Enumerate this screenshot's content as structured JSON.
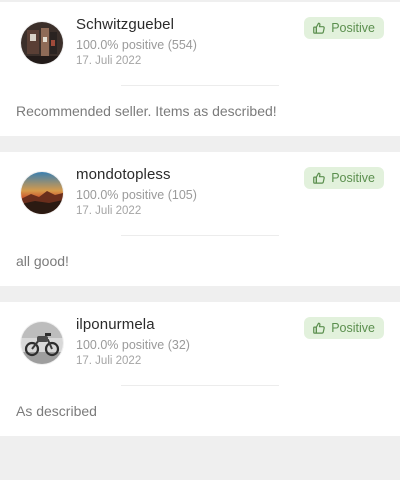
{
  "reviews": [
    {
      "username": "Schwitzguebel",
      "stats": "100.0% positive (554)",
      "date": "17. Juli 2022",
      "badge": "Positive",
      "comment": "Recommended seller. Items as described!"
    },
    {
      "username": "mondotopless",
      "stats": "100.0% positive (105)",
      "date": "17. Juli 2022",
      "badge": "Positive",
      "comment": "all good!"
    },
    {
      "username": "ilponurmela",
      "stats": "100.0% positive (32)",
      "date": "17. Juli 2022",
      "badge": "Positive",
      "comment": "As described"
    }
  ],
  "colors": {
    "badge_bg": "#e2f1dc",
    "badge_text": "#5b8f4e",
    "page_bg": "#efefef"
  },
  "icons": {
    "badge": "thumbs-up-icon"
  }
}
